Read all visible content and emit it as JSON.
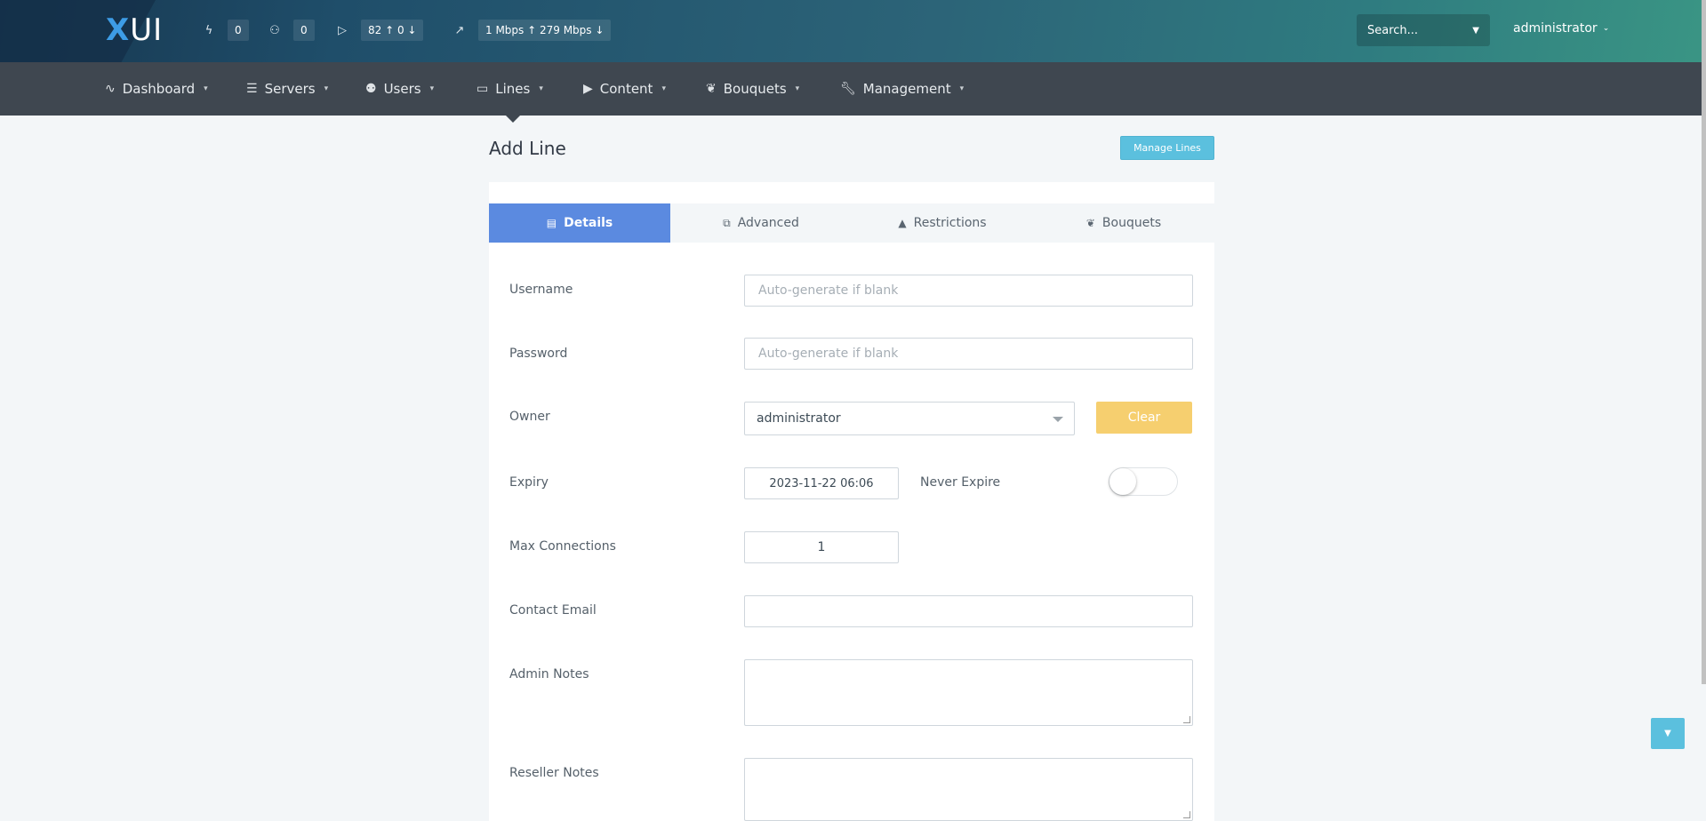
{
  "header": {
    "logo_x": "X",
    "logo_rest": "UI",
    "stats": [
      {
        "icon": "bolt-icon",
        "value": "0"
      },
      {
        "icon": "users-icon",
        "value": "0"
      },
      {
        "icon": "play-icon",
        "value": "82 ↑  0 ↓"
      },
      {
        "icon": "trend-icon",
        "value": "1 Mbps ↑   279 Mbps ↓"
      }
    ],
    "search_placeholder": "Search...",
    "user": "administrator"
  },
  "nav": {
    "items": [
      {
        "label": "Dashboard"
      },
      {
        "label": "Servers"
      },
      {
        "label": "Users"
      },
      {
        "label": "Lines"
      },
      {
        "label": "Content"
      },
      {
        "label": "Bouquets"
      },
      {
        "label": "Management"
      }
    ]
  },
  "page": {
    "title": "Add Line",
    "manage_button": "Manage Lines"
  },
  "tabs": [
    {
      "label": "Details",
      "active": true
    },
    {
      "label": "Advanced"
    },
    {
      "label": "Restrictions"
    },
    {
      "label": "Bouquets"
    }
  ],
  "form": {
    "username_label": "Username",
    "username_placeholder": "Auto-generate if blank",
    "password_label": "Password",
    "password_placeholder": "Auto-generate if blank",
    "owner_label": "Owner",
    "owner_value": "administrator",
    "clear_button": "Clear",
    "expiry_label": "Expiry",
    "expiry_value": "2023-11-22 06:06",
    "never_expire_label": "Never Expire",
    "never_expire_on": false,
    "max_connections_label": "Max Connections",
    "max_connections_value": "1",
    "contact_email_label": "Contact Email",
    "contact_email_value": "",
    "admin_notes_label": "Admin Notes",
    "admin_notes_value": "",
    "reseller_notes_label": "Reseller Notes",
    "reseller_notes_value": ""
  },
  "colors": {
    "accent_tab": "#5b8ae0",
    "info_button": "#5bc0de",
    "warning_button": "#f6cf6f",
    "nav_bg": "#3f4750"
  }
}
